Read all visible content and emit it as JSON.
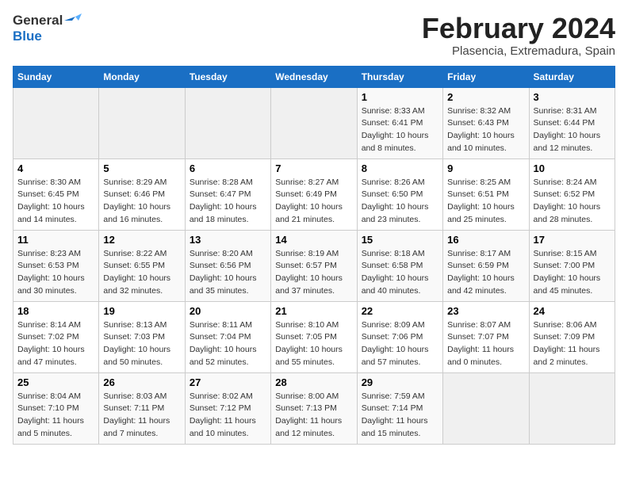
{
  "header": {
    "logo_general": "General",
    "logo_blue": "Blue",
    "month_title": "February 2024",
    "subtitle": "Plasencia, Extremadura, Spain"
  },
  "days_of_week": [
    "Sunday",
    "Monday",
    "Tuesday",
    "Wednesday",
    "Thursday",
    "Friday",
    "Saturday"
  ],
  "weeks": [
    [
      {
        "day": "",
        "info": ""
      },
      {
        "day": "",
        "info": ""
      },
      {
        "day": "",
        "info": ""
      },
      {
        "day": "",
        "info": ""
      },
      {
        "day": "1",
        "info": "Sunrise: 8:33 AM\nSunset: 6:41 PM\nDaylight: 10 hours\nand 8 minutes."
      },
      {
        "day": "2",
        "info": "Sunrise: 8:32 AM\nSunset: 6:43 PM\nDaylight: 10 hours\nand 10 minutes."
      },
      {
        "day": "3",
        "info": "Sunrise: 8:31 AM\nSunset: 6:44 PM\nDaylight: 10 hours\nand 12 minutes."
      }
    ],
    [
      {
        "day": "4",
        "info": "Sunrise: 8:30 AM\nSunset: 6:45 PM\nDaylight: 10 hours\nand 14 minutes."
      },
      {
        "day": "5",
        "info": "Sunrise: 8:29 AM\nSunset: 6:46 PM\nDaylight: 10 hours\nand 16 minutes."
      },
      {
        "day": "6",
        "info": "Sunrise: 8:28 AM\nSunset: 6:47 PM\nDaylight: 10 hours\nand 18 minutes."
      },
      {
        "day": "7",
        "info": "Sunrise: 8:27 AM\nSunset: 6:49 PM\nDaylight: 10 hours\nand 21 minutes."
      },
      {
        "day": "8",
        "info": "Sunrise: 8:26 AM\nSunset: 6:50 PM\nDaylight: 10 hours\nand 23 minutes."
      },
      {
        "day": "9",
        "info": "Sunrise: 8:25 AM\nSunset: 6:51 PM\nDaylight: 10 hours\nand 25 minutes."
      },
      {
        "day": "10",
        "info": "Sunrise: 8:24 AM\nSunset: 6:52 PM\nDaylight: 10 hours\nand 28 minutes."
      }
    ],
    [
      {
        "day": "11",
        "info": "Sunrise: 8:23 AM\nSunset: 6:53 PM\nDaylight: 10 hours\nand 30 minutes."
      },
      {
        "day": "12",
        "info": "Sunrise: 8:22 AM\nSunset: 6:55 PM\nDaylight: 10 hours\nand 32 minutes."
      },
      {
        "day": "13",
        "info": "Sunrise: 8:20 AM\nSunset: 6:56 PM\nDaylight: 10 hours\nand 35 minutes."
      },
      {
        "day": "14",
        "info": "Sunrise: 8:19 AM\nSunset: 6:57 PM\nDaylight: 10 hours\nand 37 minutes."
      },
      {
        "day": "15",
        "info": "Sunrise: 8:18 AM\nSunset: 6:58 PM\nDaylight: 10 hours\nand 40 minutes."
      },
      {
        "day": "16",
        "info": "Sunrise: 8:17 AM\nSunset: 6:59 PM\nDaylight: 10 hours\nand 42 minutes."
      },
      {
        "day": "17",
        "info": "Sunrise: 8:15 AM\nSunset: 7:00 PM\nDaylight: 10 hours\nand 45 minutes."
      }
    ],
    [
      {
        "day": "18",
        "info": "Sunrise: 8:14 AM\nSunset: 7:02 PM\nDaylight: 10 hours\nand 47 minutes."
      },
      {
        "day": "19",
        "info": "Sunrise: 8:13 AM\nSunset: 7:03 PM\nDaylight: 10 hours\nand 50 minutes."
      },
      {
        "day": "20",
        "info": "Sunrise: 8:11 AM\nSunset: 7:04 PM\nDaylight: 10 hours\nand 52 minutes."
      },
      {
        "day": "21",
        "info": "Sunrise: 8:10 AM\nSunset: 7:05 PM\nDaylight: 10 hours\nand 55 minutes."
      },
      {
        "day": "22",
        "info": "Sunrise: 8:09 AM\nSunset: 7:06 PM\nDaylight: 10 hours\nand 57 minutes."
      },
      {
        "day": "23",
        "info": "Sunrise: 8:07 AM\nSunset: 7:07 PM\nDaylight: 11 hours\nand 0 minutes."
      },
      {
        "day": "24",
        "info": "Sunrise: 8:06 AM\nSunset: 7:09 PM\nDaylight: 11 hours\nand 2 minutes."
      }
    ],
    [
      {
        "day": "25",
        "info": "Sunrise: 8:04 AM\nSunset: 7:10 PM\nDaylight: 11 hours\nand 5 minutes."
      },
      {
        "day": "26",
        "info": "Sunrise: 8:03 AM\nSunset: 7:11 PM\nDaylight: 11 hours\nand 7 minutes."
      },
      {
        "day": "27",
        "info": "Sunrise: 8:02 AM\nSunset: 7:12 PM\nDaylight: 11 hours\nand 10 minutes."
      },
      {
        "day": "28",
        "info": "Sunrise: 8:00 AM\nSunset: 7:13 PM\nDaylight: 11 hours\nand 12 minutes."
      },
      {
        "day": "29",
        "info": "Sunrise: 7:59 AM\nSunset: 7:14 PM\nDaylight: 11 hours\nand 15 minutes."
      },
      {
        "day": "",
        "info": ""
      },
      {
        "day": "",
        "info": ""
      }
    ]
  ]
}
